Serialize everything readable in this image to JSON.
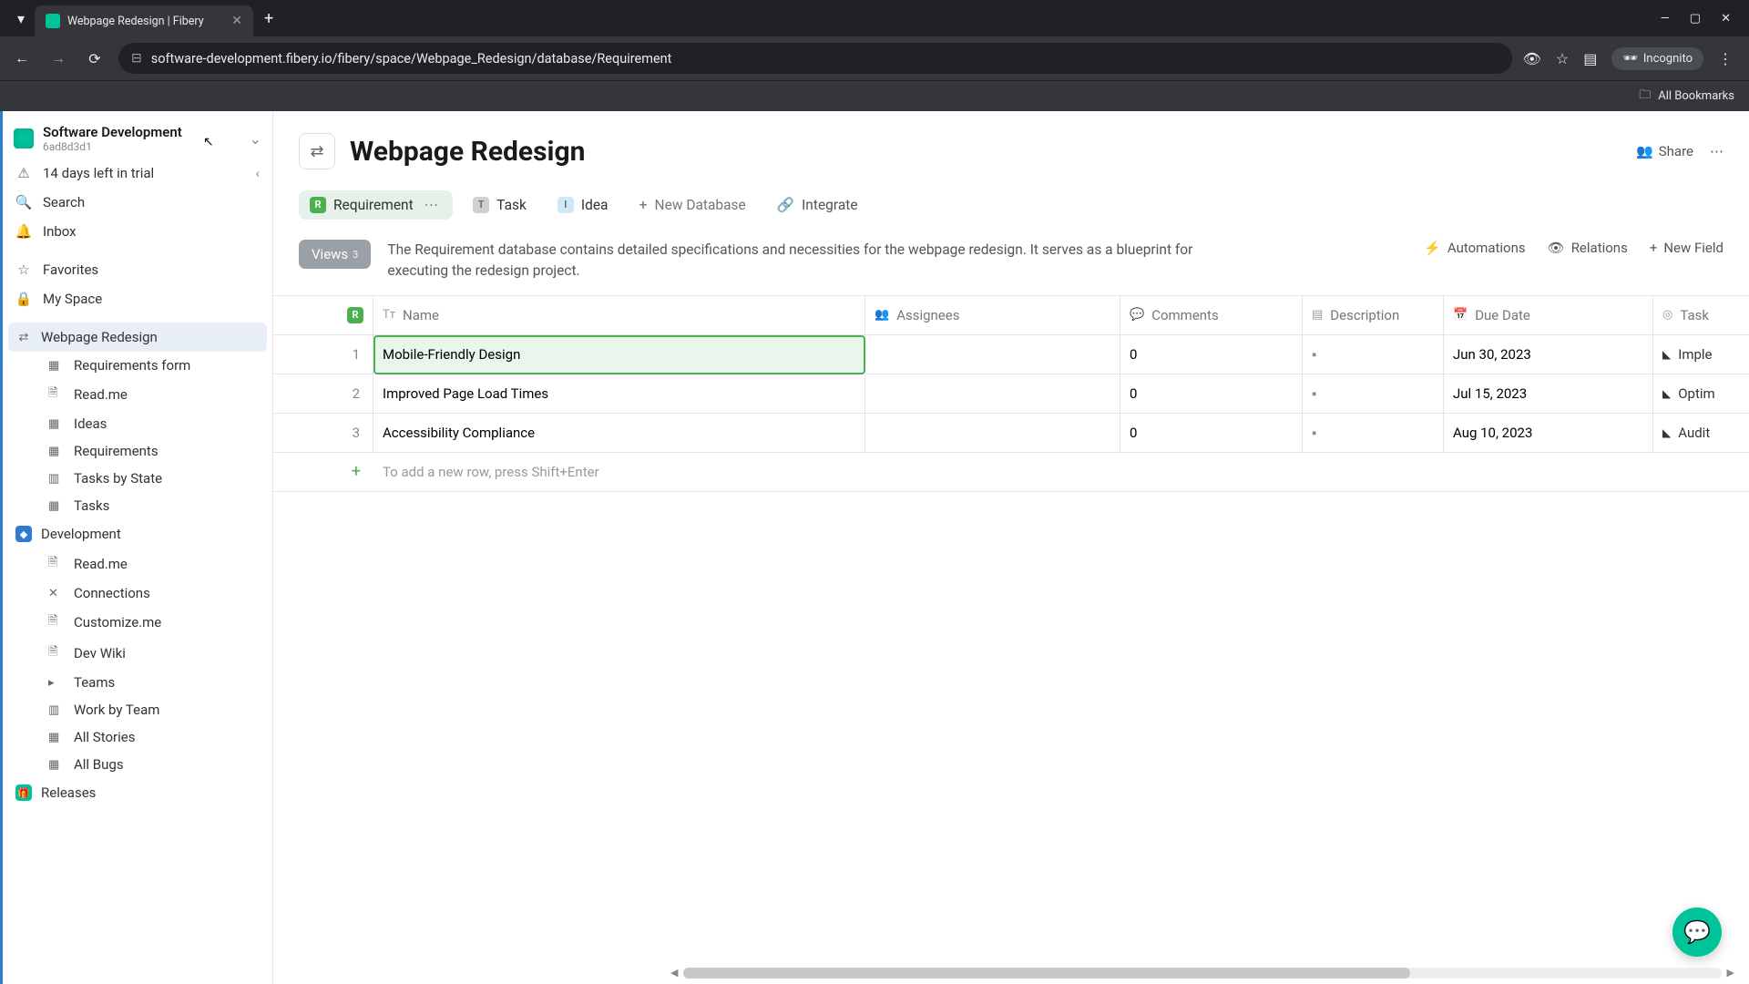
{
  "browser": {
    "tab_title": "Webpage Redesign | Fibery",
    "url": "software-development.fibery.io/fibery/space/Webpage_Redesign/database/Requirement",
    "incognito_label": "Incognito",
    "bookmarks_label": "All Bookmarks"
  },
  "workspace": {
    "name": "Software Development",
    "id": "6ad8d3d1"
  },
  "sidebar": {
    "trial": "14 days left in trial",
    "search": "Search",
    "inbox": "Inbox",
    "favorites": "Favorites",
    "myspace": "My Space",
    "spaces": [
      {
        "name": "Webpage Redesign",
        "active": true,
        "children": [
          "Requirements form",
          "Read.me",
          "Ideas",
          "Requirements",
          "Tasks by State",
          "Tasks"
        ]
      },
      {
        "name": "Development",
        "active": false,
        "children": [
          "Read.me",
          "Connections",
          "Customize.me",
          "Dev Wiki",
          "Teams",
          "Work by Team",
          "All Stories",
          "All Bugs"
        ]
      },
      {
        "name": "Releases",
        "active": false,
        "children": []
      }
    ]
  },
  "page": {
    "title": "Webpage Redesign",
    "share": "Share"
  },
  "tabs": {
    "requirement": "Requirement",
    "task": "Task",
    "idea": "Idea",
    "new_db": "New Database",
    "integrate": "Integrate"
  },
  "toolbar": {
    "views_label": "Views",
    "views_count": "3",
    "description": "The Requirement database contains detailed specifications and necessities for the webpage redesign. It serves as a blueprint for executing the redesign project.",
    "automations": "Automations",
    "relations": "Relations",
    "new_field": "New Field"
  },
  "table": {
    "columns": [
      "Name",
      "Assignees",
      "Comments",
      "Description",
      "Due Date",
      "Task"
    ],
    "rows": [
      {
        "num": "1",
        "name": "Mobile-Friendly Design",
        "assignees": "",
        "comments": "0",
        "due": "Jun 30, 2023",
        "task": "Imple"
      },
      {
        "num": "2",
        "name": "Improved Page Load Times",
        "assignees": "",
        "comments": "0",
        "due": "Jul 15, 2023",
        "task": "Optim"
      },
      {
        "num": "3",
        "name": "Accessibility Compliance",
        "assignees": "",
        "comments": "0",
        "due": "Aug 10, 2023",
        "task": "Audit"
      }
    ],
    "add_hint": "To add a new row, press Shift+Enter"
  }
}
